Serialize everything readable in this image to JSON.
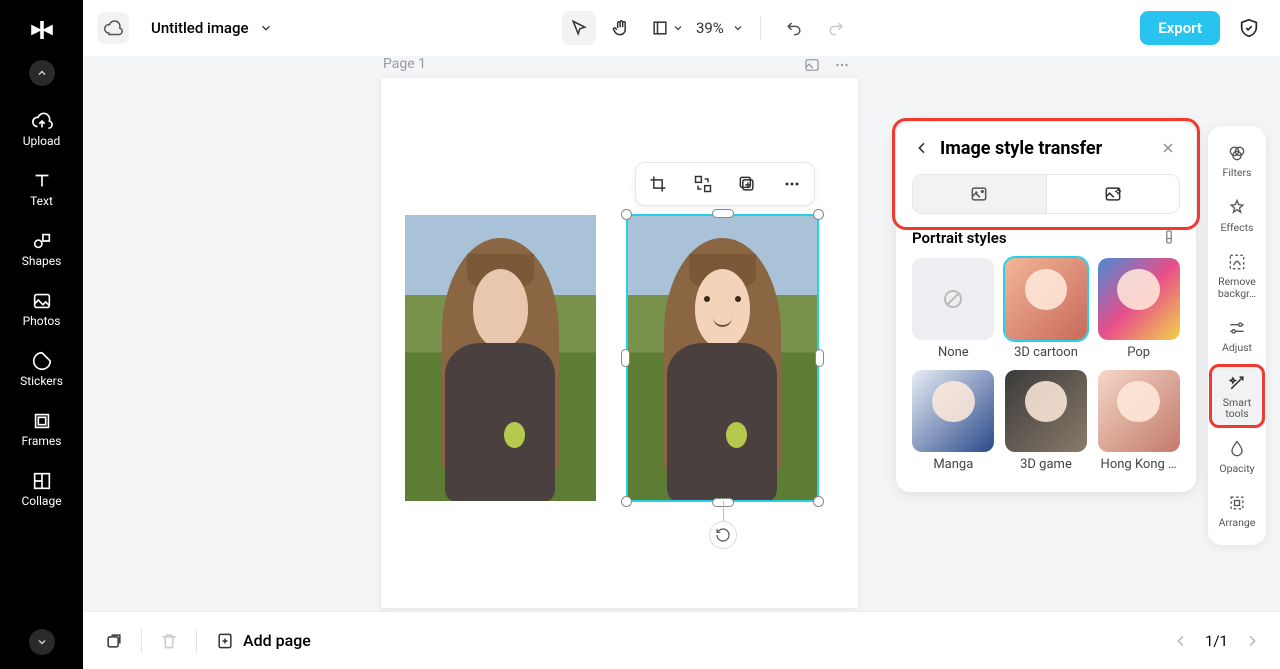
{
  "app": {
    "title": "Untitled image",
    "export_label": "Export"
  },
  "left_rail": {
    "items": [
      {
        "label": "Upload"
      },
      {
        "label": "Text"
      },
      {
        "label": "Shapes"
      },
      {
        "label": "Photos"
      },
      {
        "label": "Stickers"
      },
      {
        "label": "Frames"
      },
      {
        "label": "Collage"
      }
    ]
  },
  "toolbar": {
    "zoom": "39%"
  },
  "canvas": {
    "page_label": "Page 1"
  },
  "context_toolbar": {
    "crop": "crop",
    "replace": "replace",
    "group": "group",
    "more": "more"
  },
  "right_rail": {
    "items": [
      {
        "label": "Filters"
      },
      {
        "label": "Effects"
      },
      {
        "label": "Remove backgr…"
      },
      {
        "label": "Adjust"
      },
      {
        "label": "Smart tools"
      },
      {
        "label": "Opacity"
      },
      {
        "label": "Arrange"
      }
    ],
    "active_index": 4
  },
  "style_panel": {
    "title": "Image style transfer",
    "section": "Portrait styles",
    "selected_index": 1,
    "styles": [
      {
        "label": "None"
      },
      {
        "label": "3D cartoon"
      },
      {
        "label": "Pop"
      },
      {
        "label": "Manga"
      },
      {
        "label": "3D game"
      },
      {
        "label": "Hong Kong …"
      }
    ]
  },
  "bottombar": {
    "add_page": "Add page",
    "page_indicator": "1/1"
  }
}
